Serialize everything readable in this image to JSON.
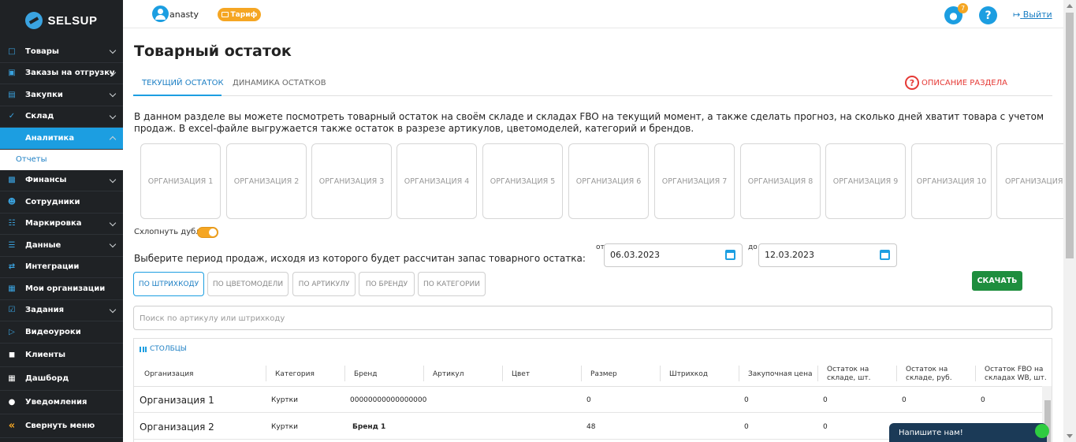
{
  "brand": {
    "name": "SELSUP"
  },
  "sidebar": {
    "items": [
      {
        "label": "Товары",
        "icon": "bag-icon",
        "expandable": true
      },
      {
        "label": "Заказы на отгрузку",
        "icon": "orders-icon",
        "expandable": true
      },
      {
        "label": "Закупки",
        "icon": "cart-icon",
        "expandable": true
      },
      {
        "label": "Склад",
        "icon": "check-circle-icon",
        "expandable": true
      },
      {
        "label": "Аналитика",
        "icon": "analytics-icon",
        "expandable": true,
        "active": true
      },
      {
        "label": "Финансы",
        "icon": "wallet-icon",
        "expandable": true
      },
      {
        "label": "Сотрудники",
        "icon": "user-icon",
        "expandable": false
      },
      {
        "label": "Маркировка",
        "icon": "barcode-icon",
        "expandable": true
      },
      {
        "label": "Данные",
        "icon": "document-icon",
        "expandable": true
      },
      {
        "label": "Интеграции",
        "icon": "integration-icon",
        "expandable": false
      },
      {
        "label": "Мои организации",
        "icon": "building-icon",
        "expandable": false
      },
      {
        "label": "Задания",
        "icon": "tasks-icon",
        "expandable": true
      },
      {
        "label": "Видеоуроки",
        "icon": "video-icon",
        "expandable": false
      },
      {
        "label": "Клиенты",
        "icon": "lock-icon",
        "expandable": false
      },
      {
        "label": "Дашборд",
        "icon": "grid-icon",
        "expandable": false
      },
      {
        "label": "Уведомления",
        "icon": "bell-icon",
        "expandable": false
      },
      {
        "label": "Свернуть меню",
        "icon": "collapse-icon",
        "expandable": false
      }
    ],
    "sub_item": "Отчеты"
  },
  "topbar": {
    "username": "anasty",
    "tariff_label": "Тариф",
    "notifications_count": "7",
    "help_label": "?",
    "logout_label": "Выйти"
  },
  "page": {
    "title": "Товарный остаток",
    "tabs": [
      {
        "label": "ТЕКУЩИЙ ОСТАТОК",
        "active": true
      },
      {
        "label": "ДИНАМИКА ОСТАТКОВ",
        "active": false
      }
    ],
    "description_link": "ОПИСАНИЕ РАЗДЕЛА",
    "intro": "В данном разделе вы можете посмотреть товарный остаток на своём складе и складах FBO на текущий момент, а также сделать прогноз, на сколько дней хватит товара с учетом продаж. В excel-файле выгружается также остаток в разрезе артикулов, цветомоделей, категорий и брендов.",
    "organizations": [
      "ОРГАНИЗАЦИЯ 1",
      "ОРГАНИЗАЦИЯ 2",
      "ОРГАНИЗАЦИЯ 3",
      "ОРГАНИЗАЦИЯ 4",
      "ОРГАНИЗАЦИЯ 5",
      "ОРГАНИЗАЦИЯ 6",
      "ОРГАНИЗАЦИЯ 7",
      "ОРГАНИЗАЦИЯ 8",
      "ОРГАНИЗАЦИЯ 9",
      "ОРГАНИЗАЦИЯ 10",
      "ОРГАНИЗАЦИЯ"
    ],
    "dedupe_label": "Схлопнуть дубли",
    "period_label": "Выберите период продаж, исходя из которого будет рассчитан запас товарного остатка:",
    "date_from_label": "от",
    "date_from": "06.03.2023",
    "date_to_label": "до",
    "date_to": "12.03.2023",
    "group_buttons": [
      {
        "label": "ПО ШТРИХКОДУ",
        "active": true
      },
      {
        "label": "ПО ЦВЕТОМОДЕЛИ",
        "active": false
      },
      {
        "label": "ПО АРТИКУЛУ",
        "active": false
      },
      {
        "label": "ПО БРЕНДУ",
        "active": false
      },
      {
        "label": "ПО КАТЕГОРИИ",
        "active": false
      }
    ],
    "download_label": "СКАЧАТЬ",
    "search_placeholder": "Поиск по артикулу или штрихкоду"
  },
  "table": {
    "columns_label": "СТОЛБЦЫ",
    "headers": [
      "Организация",
      "Категория",
      "Бренд",
      "Артикул",
      "Цвет",
      "Размер",
      "Штрихкод",
      "Закупочная цена",
      "Остаток на складе, шт.",
      "Остаток на складе, руб.",
      "Остаток FBO на складах WB, шт."
    ],
    "rows": [
      [
        "Организация 1",
        "Куртки",
        "00000000000000000",
        "",
        "",
        "0",
        "",
        "0",
        "0",
        "0",
        "0"
      ],
      [
        "Организация 2",
        "Куртки",
        "Бренд 1",
        "",
        "",
        "48",
        "",
        "0",
        "0",
        "",
        ""
      ]
    ]
  },
  "chat": {
    "label": "Напишите нам!"
  },
  "colors": {
    "sidebar": "#1f2225",
    "accent": "#1c9ee1",
    "tariff": "#f5a623",
    "download": "#1e8e3e",
    "danger": "#e53935"
  }
}
